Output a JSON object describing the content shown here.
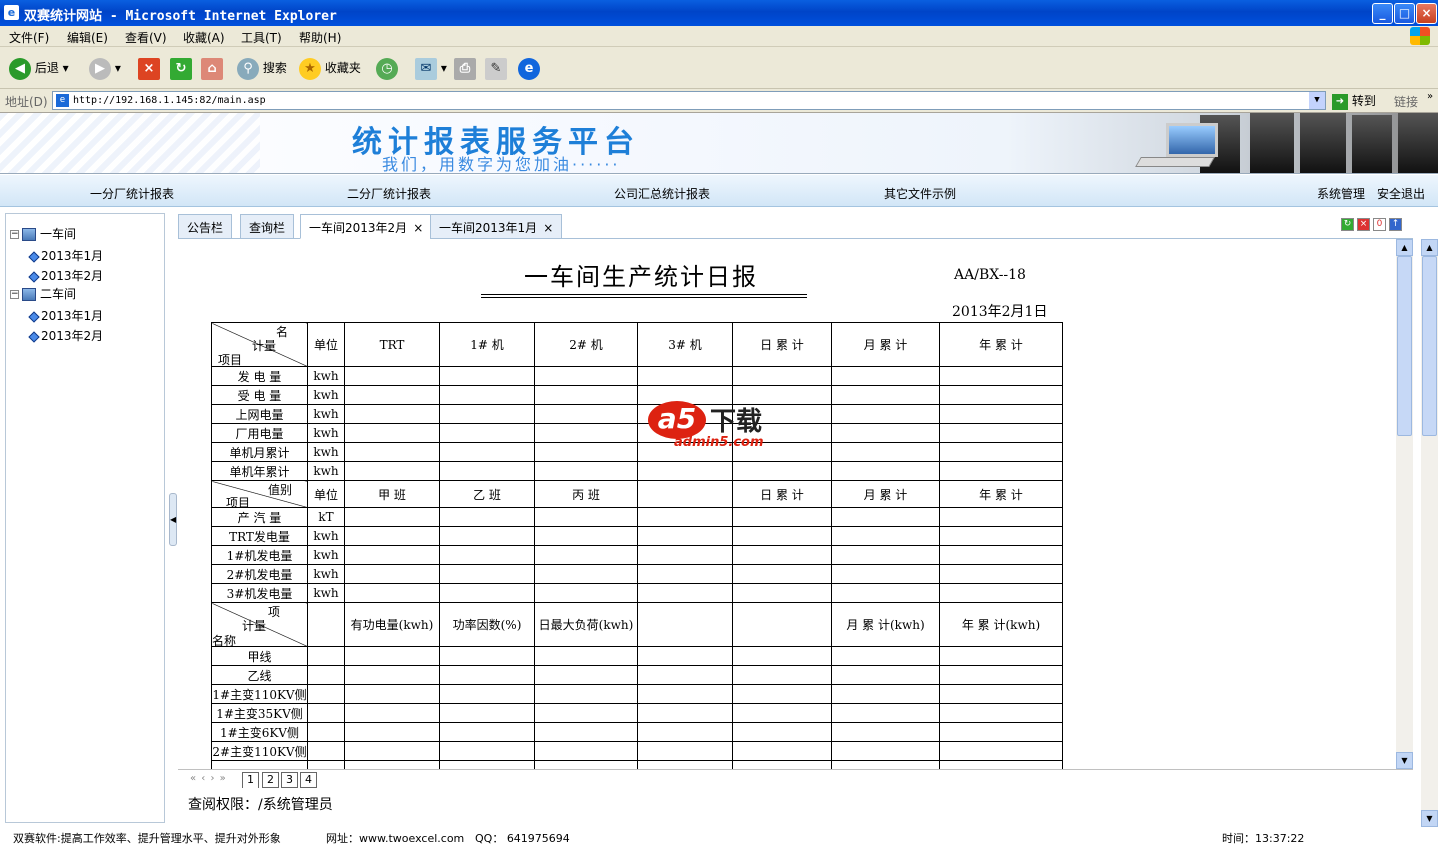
{
  "window": {
    "title": "双赛统计网站 - Microsoft Internet Explorer",
    "btn_min": "_",
    "btn_max": "□",
    "btn_close": "×"
  },
  "menu": [
    "文件(F)",
    "编辑(E)",
    "查看(V)",
    "收藏(A)",
    "工具(T)",
    "帮助(H)"
  ],
  "toolbar": {
    "back": "后退",
    "search": "搜索",
    "favorites": "收藏夹"
  },
  "address": {
    "label": "地址(D)",
    "url": "http://192.168.1.145:82/main.asp",
    "go": "转到",
    "links": "链接"
  },
  "banner": {
    "title": "统计报表服务平台",
    "subtitle": "我们，用数字为您加油······"
  },
  "nav": {
    "items": [
      "一分厂统计报表",
      "二分厂统计报表",
      "公司汇总统计报表",
      "其它文件示例"
    ],
    "admin": "系统管理",
    "logout": "安全退出"
  },
  "tree": [
    {
      "label": "一车间",
      "children": [
        "2013年1月",
        "2013年2月"
      ]
    },
    {
      "label": "二车间",
      "children": [
        "2013年1月",
        "2013年2月"
      ]
    }
  ],
  "tabs": [
    {
      "label": "公告栏",
      "closable": false
    },
    {
      "label": "查询栏",
      "closable": false
    },
    {
      "label": "一车间2013年2月",
      "closable": true,
      "active": true
    },
    {
      "label": "一车间2013年1月",
      "closable": true
    }
  ],
  "tab_close": "×",
  "report": {
    "title": "一车间生产统计日报",
    "code": "AA/BX--18",
    "date": "2013年2月1日",
    "s1": {
      "diag_top": "名",
      "diag_mid": "计量",
      "diag_bottom": "项目",
      "unit": "单位",
      "cols": [
        "TRT",
        "1# 机",
        "2# 机",
        "3# 机",
        "日 累 计",
        "月 累 计",
        "年 累 计"
      ],
      "rows": [
        [
          "发 电 量",
          "kwh"
        ],
        [
          "受 电 量",
          "kwh"
        ],
        [
          "上网电量",
          "kwh"
        ],
        [
          "厂用电量",
          "kwh"
        ],
        [
          "单机月累计",
          "kwh"
        ],
        [
          "单机年累计",
          "kwh"
        ]
      ]
    },
    "s2": {
      "diag_top": "值别",
      "diag_bottom": "项目",
      "unit": "单位",
      "cols": [
        "甲 班",
        "乙 班",
        "丙 班",
        "",
        "日 累 计",
        "月 累 计",
        "年 累 计"
      ],
      "rows": [
        [
          "产 汽 量",
          "kT"
        ],
        [
          "TRT发电量",
          "kwh"
        ],
        [
          "1#机发电量",
          "kwh"
        ],
        [
          "2#机发电量",
          "kwh"
        ],
        [
          "3#机发电量",
          "kwh"
        ]
      ]
    },
    "s3": {
      "diag_top": "项",
      "diag_mid": "计量",
      "diag_bottom": "名称",
      "cols": [
        "",
        "有功电量(kwh)",
        "功率因数(%)",
        "日最大负荷(kwh)",
        "",
        "",
        "月 累 计(kwh)",
        "年 累 计(kwh)"
      ],
      "rows": [
        "甲线",
        "乙线",
        "1#主变110KV侧",
        "1#主变35KV侧",
        "1#主变6KV侧",
        "2#主变110KV侧"
      ]
    }
  },
  "watermark": {
    "logo": "a5",
    "text": "下载",
    "url": "admin5.com"
  },
  "pager": {
    "nav": "« ‹ › »",
    "pages": [
      "1",
      "2",
      "3",
      "4"
    ]
  },
  "permission": "查阅权限：/系统管理员",
  "footer": {
    "slogan": "双赛软件:提高工作效率、提升管理水平、提升对外形象",
    "site": "网址：www.twoexcel.com",
    "qq": "QQ： 641975694",
    "time": "时间：13:37:22"
  }
}
